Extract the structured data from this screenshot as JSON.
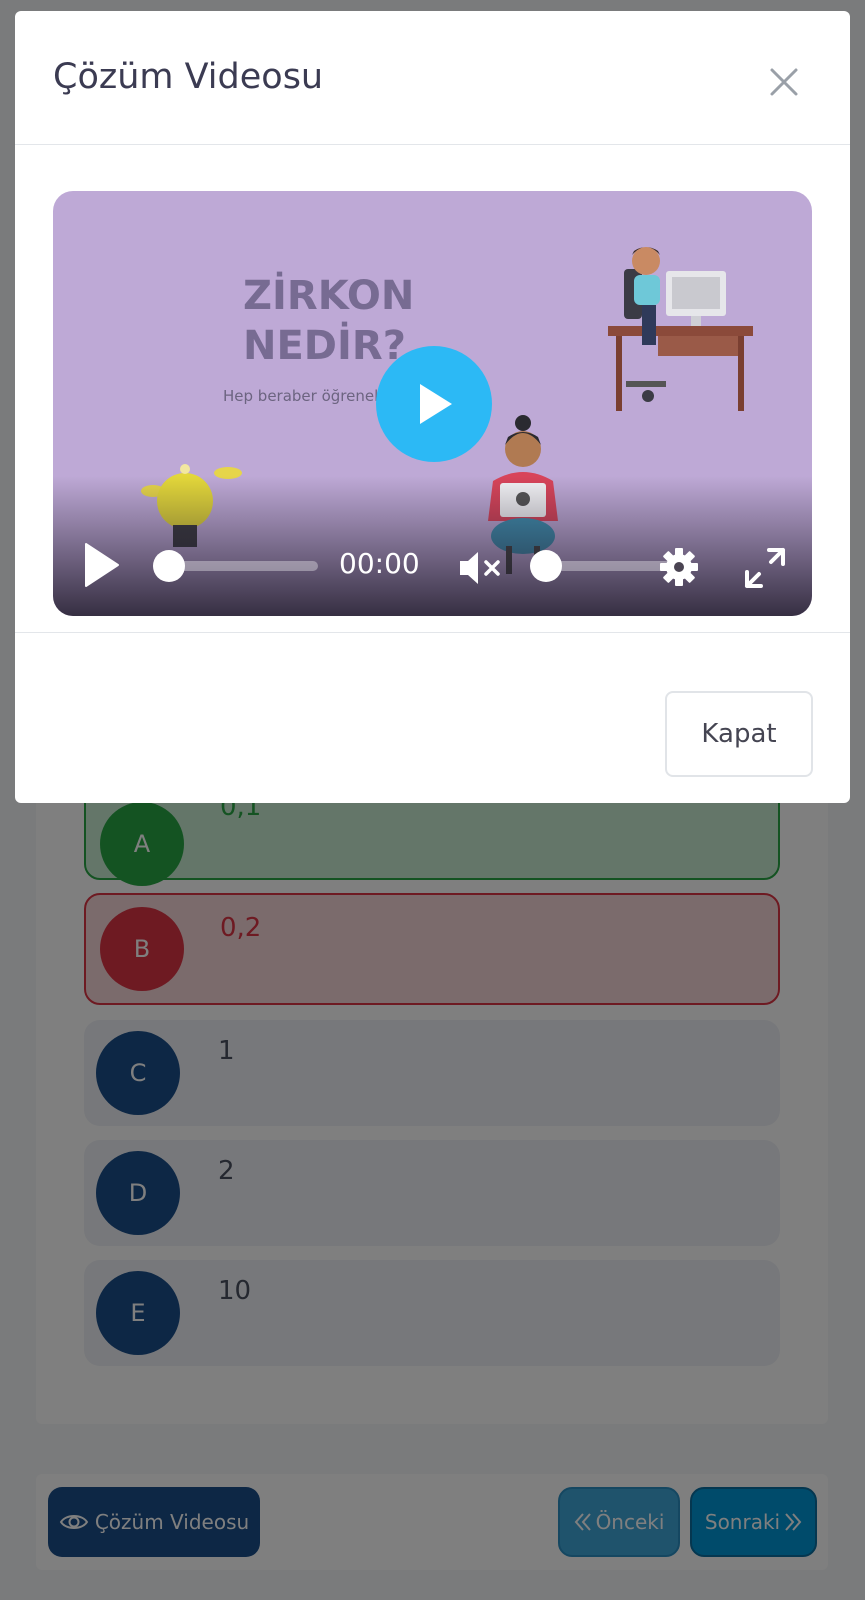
{
  "modal": {
    "title": "Çözüm Videosu",
    "close_icon": "close-icon",
    "video": {
      "title_line1": "ZİRKON",
      "title_line2": "NEDİR?",
      "subtitle": "Hep beraber öğrenelim",
      "time": "00:00",
      "progress": 0,
      "volume": 0,
      "muted": true,
      "accent_color": "#2cb9f5",
      "icons": [
        "play-icon",
        "volume-mute-icon",
        "settings-icon",
        "fullscreen-icon"
      ]
    },
    "close_button_label": "Kapat"
  },
  "answers": [
    {
      "letter": "A",
      "value": "0,1",
      "state": "correct",
      "color": "#28a745"
    },
    {
      "letter": "B",
      "value": "0,2",
      "state": "wrong",
      "color": "#dc3545"
    },
    {
      "letter": "C",
      "value": "1",
      "state": "neutral",
      "color": "#1a4f8b"
    },
    {
      "letter": "D",
      "value": "2",
      "state": "neutral",
      "color": "#1a4f8b"
    },
    {
      "letter": "E",
      "value": "10",
      "state": "neutral",
      "color": "#1a4f8b"
    }
  ],
  "footer": {
    "solution_video_label": "Çözüm Videosu",
    "prev_label": "Önceki",
    "next_label": "Sonraki"
  }
}
